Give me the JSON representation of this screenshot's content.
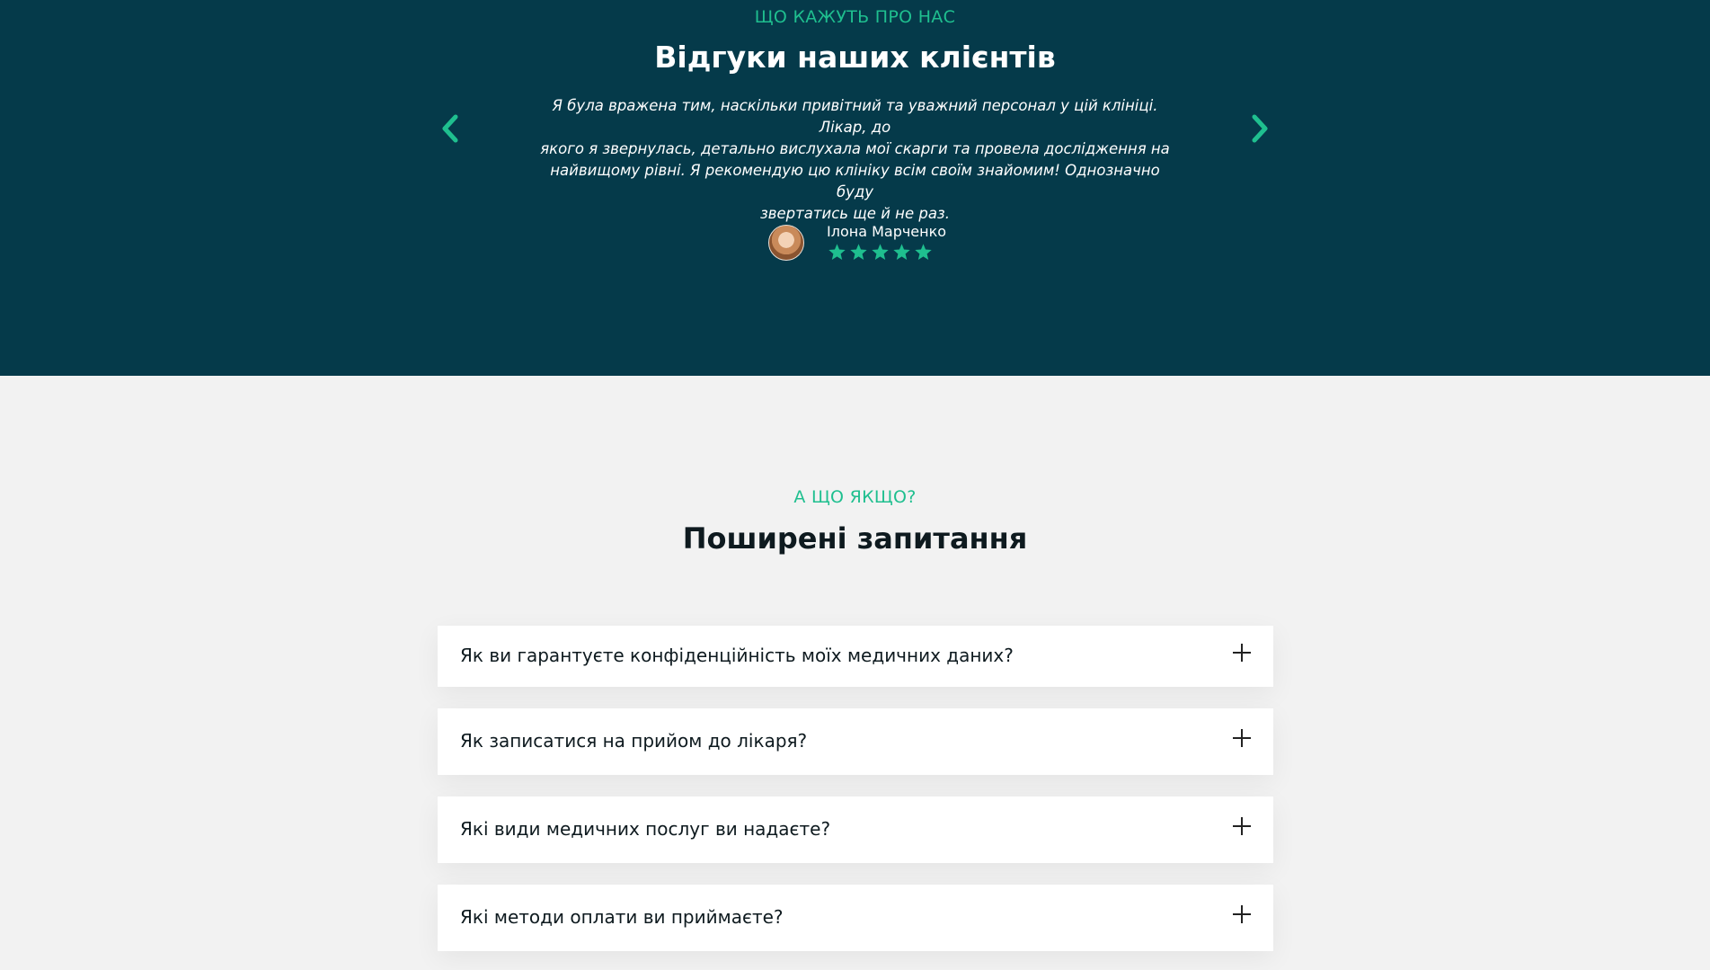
{
  "testimonials": {
    "eyebrow": "ЩО КАЖУТЬ ПРО НАС",
    "title": "Відгуки наших клієнтів",
    "quote_line1": "Я була вражена тим, наскільки привітний та уважний персонал у цій клініці. Лікар, до",
    "quote_line2": "якого я звернулась, детально вислухала мої скарги та провела дослідження на",
    "quote_line3": "найвищому рівні. Я рекомендую цю клініку всім своїм знайомим! Однозначно буду",
    "quote_line4": "звертатись ще й не раз.",
    "author_name": "Ілона Марченко",
    "rating": 5,
    "prev_icon": "chevron-left-icon",
    "next_icon": "chevron-right-icon",
    "accent_color": "#1fbf8f",
    "background_color": "#053a4a"
  },
  "faq": {
    "eyebrow": "А ЩО ЯКЩО?",
    "title": "Поширені запитання",
    "items": [
      {
        "question": "Як ви гарантуєте конфіденційність моїх медичних даних?"
      },
      {
        "question": "Як записатися на прийом до лікаря?"
      },
      {
        "question": "Які види медичних послуг ви надаєте?"
      },
      {
        "question": "Які методи оплати ви приймаєте?"
      }
    ],
    "expand_icon": "plus-icon"
  }
}
